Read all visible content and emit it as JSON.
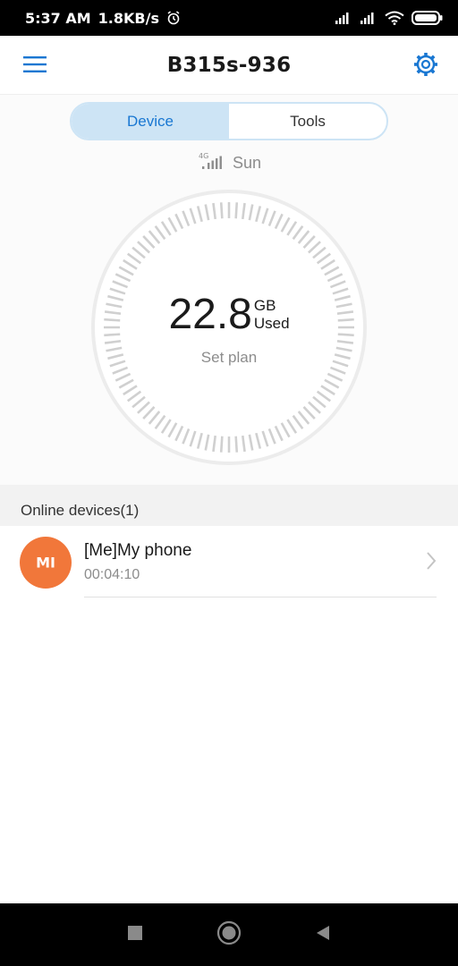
{
  "status_bar": {
    "time": "5:37 AM",
    "speed": "1.8KB/s",
    "icons": [
      "alarm-icon",
      "cellular-signal-icon",
      "cellular-signal-icon",
      "wifi-icon",
      "battery-icon"
    ]
  },
  "app_bar": {
    "title": "B315s-936",
    "icons": [
      "menu-icon",
      "gear-icon"
    ]
  },
  "tabs": [
    {
      "label": "Device",
      "active": true
    },
    {
      "label": "Tools",
      "active": false
    }
  ],
  "network": {
    "type": "4G",
    "name": "Sun",
    "icon": "signal-bars-icon"
  },
  "usage": {
    "value": "22.8",
    "unit": "GB",
    "label": "Used",
    "plan_link": "Set plan"
  },
  "online_devices": {
    "title": "Online devices(1)",
    "items": [
      {
        "name": "[Me]My phone",
        "duration": "00:04:10",
        "avatar_label": "MI",
        "icon": "chevron-right-icon"
      }
    ]
  },
  "nav_bar": {
    "icons": [
      "recents-icon",
      "home-icon",
      "back-icon"
    ]
  },
  "colors": {
    "accent": "#1977d2",
    "tab_active_bg": "#cde4f5",
    "avatar": "#f1773a",
    "gauge_ticks": "#d0d0d0"
  }
}
